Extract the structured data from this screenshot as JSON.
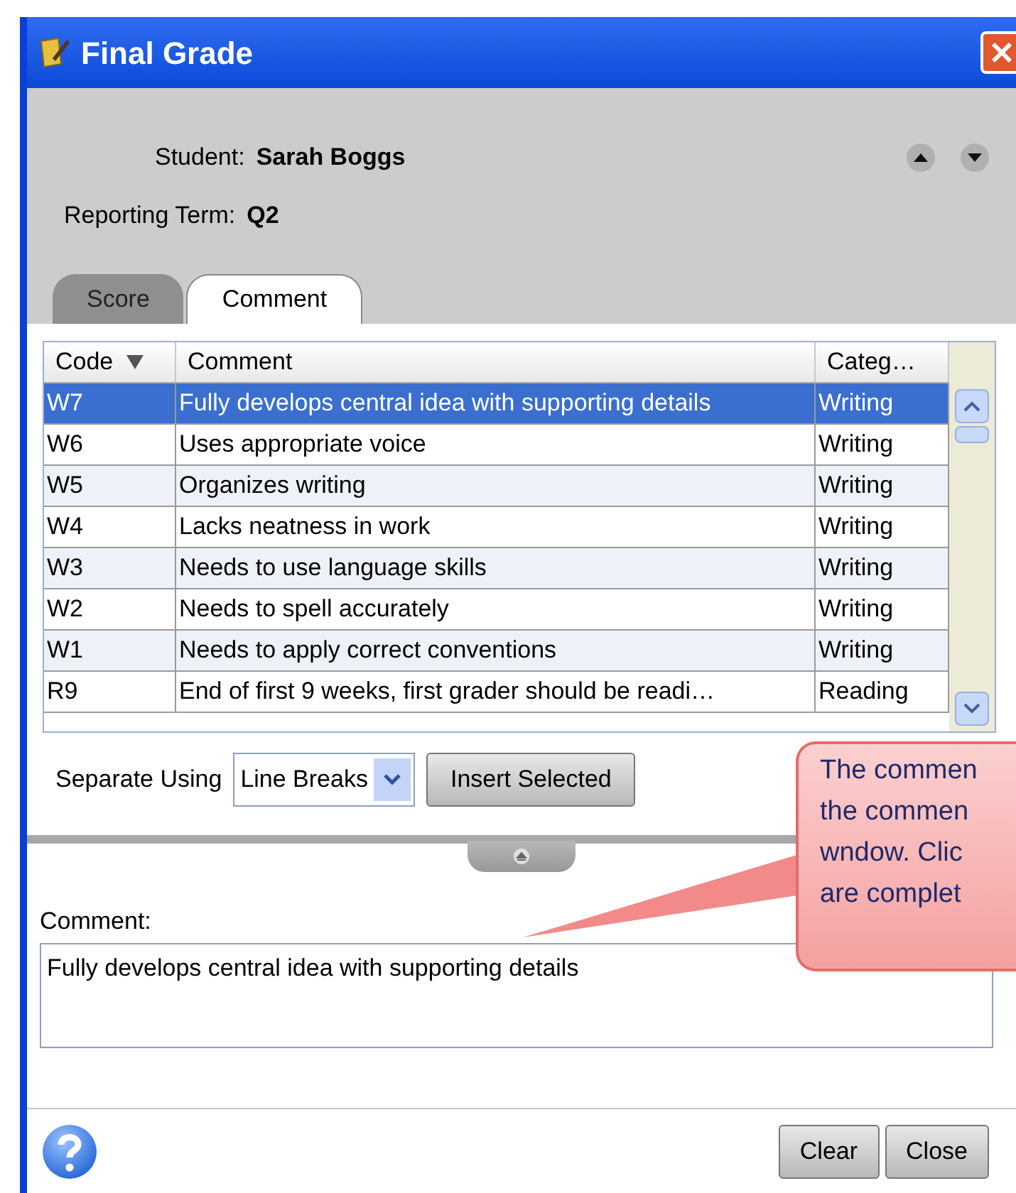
{
  "window": {
    "title": "Final Grade"
  },
  "header": {
    "student_label": "Student:",
    "student": "Sarah Boggs",
    "term_label": "Reporting Term:",
    "term": "Q2"
  },
  "tabs": [
    {
      "label": "Score",
      "selected": false
    },
    {
      "label": "Comment",
      "selected": true
    }
  ],
  "table": {
    "columns": [
      {
        "label": "Code",
        "sorted": true
      },
      {
        "label": "Comment",
        "sorted": false
      },
      {
        "label": "Categ…",
        "sorted": false
      }
    ],
    "rows": [
      {
        "code": "W7",
        "comment": "Fully develops central idea with supporting details",
        "category": "Writing",
        "selected": true
      },
      {
        "code": "W6",
        "comment": "Uses appropriate voice",
        "category": "Writing",
        "selected": false
      },
      {
        "code": "W5",
        "comment": "Organizes writing",
        "category": "Writing",
        "selected": false
      },
      {
        "code": "W4",
        "comment": "Lacks neatness in work",
        "category": "Writing",
        "selected": false
      },
      {
        "code": "W3",
        "comment": "Needs to use language skills",
        "category": "Writing",
        "selected": false
      },
      {
        "code": "W2",
        "comment": "Needs to spell accurately",
        "category": "Writing",
        "selected": false
      },
      {
        "code": "W1",
        "comment": "Needs to apply correct conventions",
        "category": "Writing",
        "selected": false
      },
      {
        "code": "R9",
        "comment": "End of first 9 weeks, first grader should be readi…",
        "category": "Reading",
        "selected": false
      }
    ]
  },
  "separate": {
    "label": "Separate Using",
    "value": "Line Breaks"
  },
  "insert_button": "Insert Selected",
  "comment": {
    "label": "Comment:",
    "value": "Fully develops central idea with supporting details"
  },
  "buttons": [
    "Clear",
    "Close"
  ],
  "callout": {
    "lines": [
      "The commen",
      "the commen",
      "wndow. Clic",
      "are complet"
    ]
  }
}
